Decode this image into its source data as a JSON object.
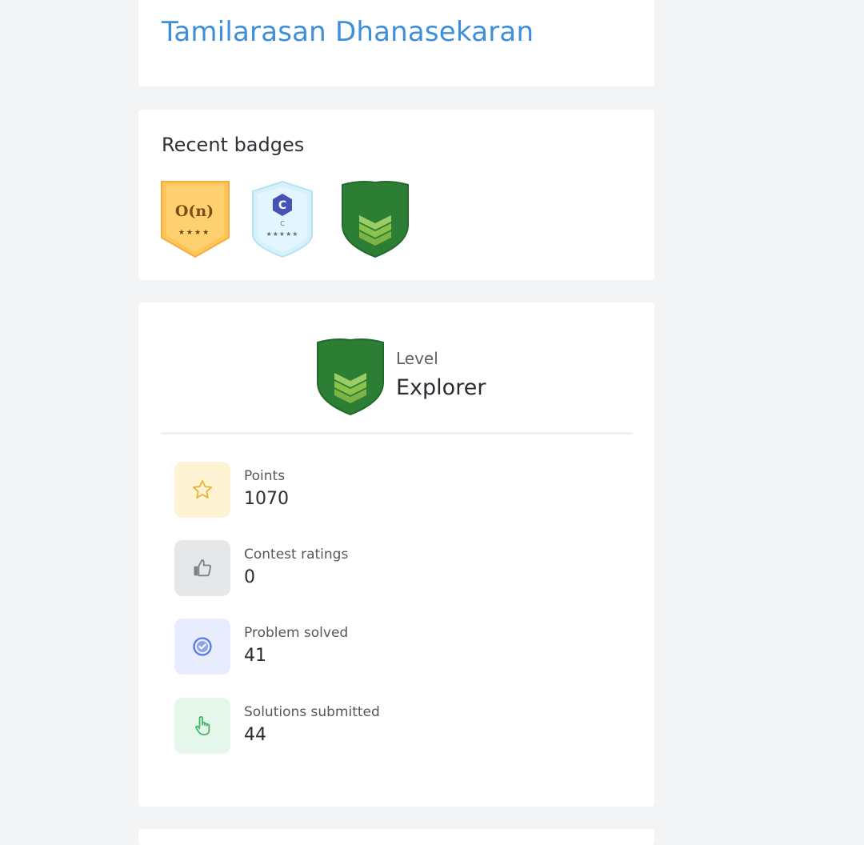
{
  "profile": {
    "name": "Tamilarasan Dhanasekaran"
  },
  "badges": {
    "title": "Recent badges",
    "items": [
      {
        "name": "complexity-badge",
        "label": "O(n)",
        "stars": "★★★★",
        "color": "#ffc55a"
      },
      {
        "name": "c-language-badge",
        "label": "C",
        "stars": "★★★★★",
        "color": "#d6f1fb"
      },
      {
        "name": "explorer-badge",
        "color": "#2b7e34"
      }
    ]
  },
  "level": {
    "label": "Level",
    "value": "Explorer",
    "icon": "explorer-shield-icon"
  },
  "stats": [
    {
      "label": "Points",
      "value": "1070",
      "icon": "star-icon",
      "bg": "#fef3d3",
      "fg": "#e8b53a"
    },
    {
      "label": "Contest ratings",
      "value": "0",
      "icon": "thumbs-up-icon",
      "bg": "#e6e7e9",
      "fg": "#7d8085"
    },
    {
      "label": "Problem solved",
      "value": "41",
      "icon": "check-circle-icon",
      "bg": "#e8edfd",
      "fg": "#5b7be3"
    },
    {
      "label": "Solutions submitted",
      "value": "44",
      "icon": "pointer-hand-icon",
      "bg": "#e4f7ea",
      "fg": "#3fb765"
    }
  ],
  "colors": {
    "accent": "#3d8fdb",
    "page_background": "#f3f4f6",
    "card_background": "#ffffff"
  }
}
